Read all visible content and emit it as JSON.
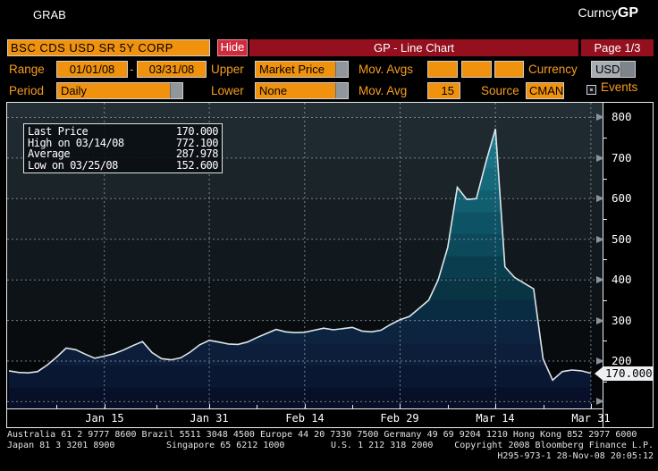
{
  "topbar": {
    "grab": "GRAB",
    "brand_prefix": "Curncy",
    "brand_suffix": "GP"
  },
  "ticker_bar": {
    "security": "BSC CDS USD SR 5Y CORP",
    "hide_label": "Hide",
    "title": "GP - Line Chart",
    "page_label": "Page 1/3"
  },
  "controls": {
    "range_label": "Range",
    "range_from": "01/01/08",
    "range_separator": "-",
    "range_to": "03/31/08",
    "upper_label": "Upper",
    "upper_value": "Market Price",
    "mov_avgs_label": "Mov. Avgs",
    "currency_label": "Currency",
    "currency_value": "USD",
    "period_label": "Period",
    "period_value": "Daily",
    "lower_label": "Lower",
    "lower_value": "None",
    "mov_avg_label": "Mov. Avg",
    "mov_avg_value": "15",
    "source_label": "Source",
    "source_value": "CMAN",
    "events_label": "Events"
  },
  "legend": {
    "rows": [
      {
        "label": "Last Price",
        "value": "170.000"
      },
      {
        "label": "High on 03/14/08",
        "value": "772.100"
      },
      {
        "label": "Average",
        "value": "287.978"
      },
      {
        "label": "Low on 03/25/08",
        "value": "152.600"
      }
    ]
  },
  "chart_data": {
    "type": "area",
    "title": "GP - Line Chart",
    "series_name": "BSC CDS USD SR 5Y CORP - Market Price",
    "x": [
      "01/01",
      "01/02",
      "01/03",
      "01/04",
      "01/07",
      "01/08",
      "01/09",
      "01/10",
      "01/11",
      "01/14",
      "01/15",
      "01/16",
      "01/17",
      "01/18",
      "01/22",
      "01/23",
      "01/24",
      "01/25",
      "01/28",
      "01/29",
      "01/30",
      "01/31",
      "02/01",
      "02/04",
      "02/05",
      "02/06",
      "02/07",
      "02/08",
      "02/11",
      "02/12",
      "02/13",
      "02/14",
      "02/15",
      "02/19",
      "02/20",
      "02/21",
      "02/22",
      "02/25",
      "02/26",
      "02/27",
      "02/28",
      "02/29",
      "03/03",
      "03/04",
      "03/05",
      "03/06",
      "03/07",
      "03/10",
      "03/11",
      "03/12",
      "03/13",
      "03/14",
      "03/17",
      "03/18",
      "03/19",
      "03/20",
      "03/24",
      "03/25",
      "03/26",
      "03/27",
      "03/28",
      "03/31"
    ],
    "values": [
      176,
      172,
      171,
      174,
      190,
      210,
      232,
      228,
      217,
      207,
      212,
      218,
      227,
      238,
      248,
      221,
      206,
      203,
      208,
      222,
      240,
      251,
      247,
      242,
      241,
      247,
      258,
      268,
      278,
      272,
      270,
      271,
      276,
      281,
      277,
      280,
      283,
      274,
      272,
      276,
      290,
      302,
      310,
      330,
      350,
      400,
      480,
      628,
      598,
      600,
      690,
      772,
      432,
      406,
      392,
      378,
      205,
      153,
      174,
      178,
      176,
      170
    ],
    "x_tick_labels": [
      "Jan 15",
      "Jan 31",
      "Feb 14",
      "Feb 29",
      "Mar 14",
      "Mar 31"
    ],
    "x_tick_indices": [
      10,
      21,
      31,
      41,
      51,
      61
    ],
    "y_tick_labels": [
      200,
      300,
      400,
      500,
      600,
      700,
      800
    ],
    "grid_values": [
      100,
      200,
      300,
      400,
      500,
      600,
      700,
      800
    ],
    "minor_tick_values": [
      150,
      250,
      350,
      450,
      550,
      650,
      750
    ],
    "ylim": [
      82,
      838
    ],
    "grid": "dashed",
    "legend_position": "top-left",
    "last_price_label": "170.000",
    "stats": {
      "last": 170.0,
      "high": 772.1,
      "high_date": "03/14/08",
      "average": 287.978,
      "low": 152.6,
      "low_date": "03/25/08"
    }
  },
  "footer": {
    "line1": "Australia 61 2 9777 8600 Brazil 5511 3048 4500 Europe 44 20 7330 7500 Germany 49 69 9204 1210 Hong Kong 852 2977 6000",
    "line2_japan": "Japan 81 3 3201 8900",
    "line2_singapore": "Singapore 65 6212 1000",
    "line2_us": "U.S. 1 212 318 2000",
    "line2_copyright": "Copyright 2008 Bloomberg Finance L.P.",
    "line3": "H295-973-1 28-Nov-08 20:05:12"
  },
  "colors": {
    "accent_orange": "#f0920e",
    "label_orange": "#f79d1f",
    "bar_red": "#94101f",
    "hide_red": "#cf2b3d",
    "line": "#dde6ea",
    "grid": "#9aa4a8",
    "tag_bg": "#eef1f2",
    "axis_text": "#ffffff",
    "fill_bands": [
      "#2a8c9e",
      "#20808f",
      "#197386",
      "#15697b",
      "#115e70",
      "#0e5365",
      "#0c495a",
      "#0a3e4f",
      "#093444",
      "#0a2c42",
      "#0c2440",
      "#0c1e3a",
      "#091732",
      "#071028"
    ]
  }
}
